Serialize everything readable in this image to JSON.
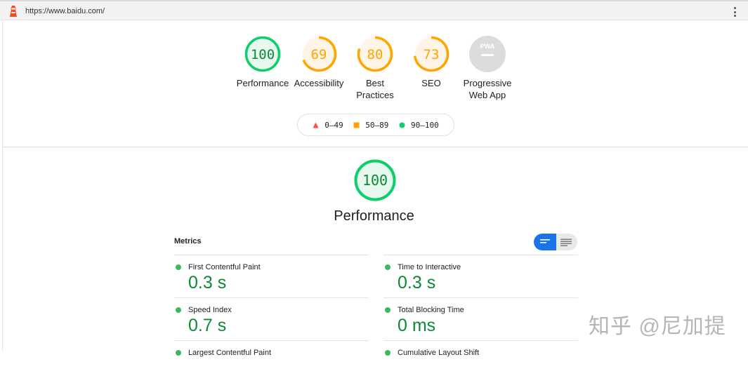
{
  "browser": {
    "url": "https://www.baidu.com/"
  },
  "colors": {
    "pass": "#0cce6b",
    "pass_text": "#0a8a36",
    "average": "#ffa400",
    "average_text": "#c33300",
    "fail": "#ff4e42",
    "pwa_gray": "#dcdcdc",
    "toggle_active": "#1a73e8"
  },
  "gauges": [
    {
      "score": "100",
      "label_lines": [
        "Performance"
      ],
      "rating": "pass"
    },
    {
      "score": "69",
      "label_lines": [
        "Accessibility"
      ],
      "rating": "average"
    },
    {
      "score": "80",
      "label_lines": [
        "Best",
        "Practices"
      ],
      "rating": "average"
    },
    {
      "score": "73",
      "label_lines": [
        "SEO"
      ],
      "rating": "average"
    },
    {
      "score": "",
      "label_lines": [
        "Progressive",
        "Web App"
      ],
      "rating": "pwa",
      "badge": "PWA"
    }
  ],
  "legend": {
    "fail": "0–49",
    "average": "50–89",
    "pass": "90–100"
  },
  "category": {
    "score": "100",
    "title": "Performance"
  },
  "metrics": {
    "heading": "Metrics",
    "left": [
      {
        "name": "First Contentful Paint",
        "value": "0.3 s"
      },
      {
        "name": "Speed Index",
        "value": "0.7 s"
      },
      {
        "name": "Largest Contentful Paint",
        "value": ""
      }
    ],
    "right": [
      {
        "name": "Time to Interactive",
        "value": "0.3 s"
      },
      {
        "name": "Total Blocking Time",
        "value": "0 ms"
      },
      {
        "name": "Cumulative Layout Shift",
        "value": ""
      }
    ]
  },
  "watermark": "知乎 @尼加提"
}
